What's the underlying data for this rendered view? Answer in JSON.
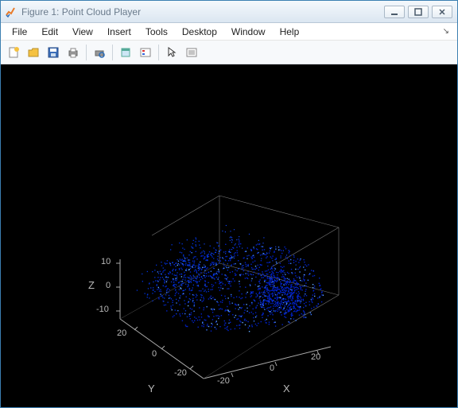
{
  "window": {
    "title": "Figure 1: Point Cloud Player"
  },
  "menu": {
    "file": "File",
    "edit": "Edit",
    "view": "View",
    "insert": "Insert",
    "tools": "Tools",
    "desktop": "Desktop",
    "window": "Window",
    "help": "Help"
  },
  "chart_data": {
    "type": "scatter",
    "title": "",
    "axes": {
      "x": {
        "label": "X",
        "ticks": [
          -20,
          0,
          20
        ]
      },
      "y": {
        "label": "Y",
        "ticks": [
          -20,
          0,
          20
        ]
      },
      "z": {
        "label": "Z",
        "ticks": [
          -10,
          0,
          10
        ]
      }
    },
    "description": "3D point cloud rendered in blue on black background. Dense cloud of points forming concentric ring/ripple patterns near origin with scattered clusters, typical of LiDAR scan data.",
    "xlim": [
      -30,
      30
    ],
    "ylim": [
      -30,
      30
    ],
    "zlim": [
      -15,
      15
    ],
    "point_color": "#0033cc",
    "background": "#000000",
    "grid": true
  }
}
